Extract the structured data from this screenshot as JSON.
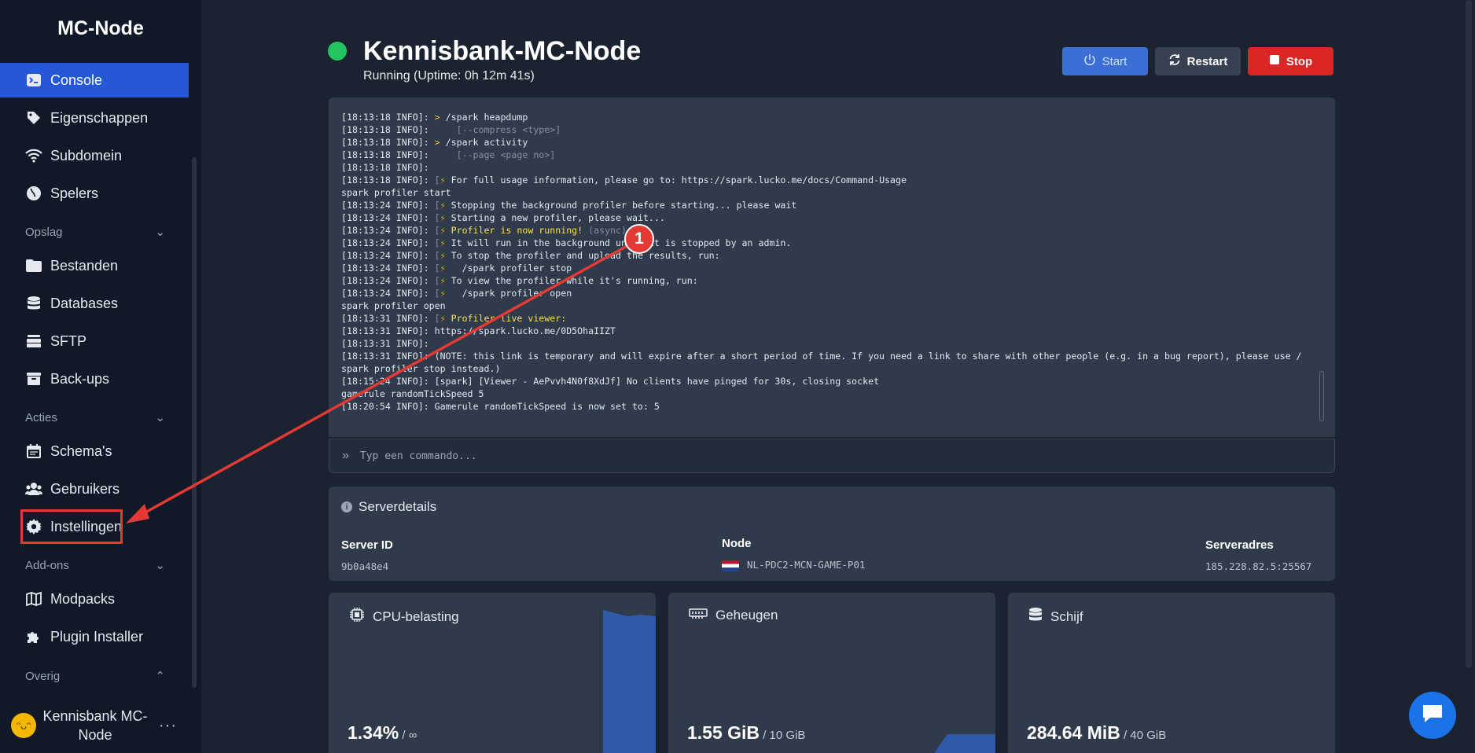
{
  "sidebar": {
    "brand": "MC-Node",
    "top_items": [
      {
        "label": "Console",
        "icon": "terminal-icon"
      },
      {
        "label": "Eigenschappen",
        "icon": "tag-icon"
      },
      {
        "label": "Subdomein",
        "icon": "wifi-icon"
      },
      {
        "label": "Spelers",
        "icon": "globe-icon"
      }
    ],
    "sections": [
      {
        "label": "Opslag",
        "items": [
          {
            "label": "Bestanden",
            "icon": "folder-icon"
          },
          {
            "label": "Databases",
            "icon": "database-icon"
          },
          {
            "label": "SFTP",
            "icon": "server-icon"
          },
          {
            "label": "Back-ups",
            "icon": "archive-icon"
          }
        ]
      },
      {
        "label": "Acties",
        "items": [
          {
            "label": "Schema's",
            "icon": "calendar-icon"
          },
          {
            "label": "Gebruikers",
            "icon": "users-icon"
          },
          {
            "label": "Instellingen",
            "icon": "gear-icon"
          }
        ]
      },
      {
        "label": "Add-ons",
        "items": [
          {
            "label": "Modpacks",
            "icon": "map-icon"
          },
          {
            "label": "Plugin Installer",
            "icon": "puzzle-icon"
          }
        ]
      },
      {
        "label": "Overig",
        "items": []
      }
    ],
    "user": {
      "name": "Kennisbank MC-Node",
      "more": "···"
    }
  },
  "server": {
    "title": "Kennisbank-MC-Node",
    "status": "Running (Uptime: 0h 12m 41s)",
    "status_color": "#22c55e",
    "buttons": {
      "start": "Start",
      "restart": "Restart",
      "stop": "Stop"
    }
  },
  "console": {
    "lines": [
      {
        "time": "[18:13:18 INFO]:",
        "parts": [
          {
            "t": " > ",
            "c": "gt"
          },
          {
            "t": "/spark heapdump"
          }
        ]
      },
      {
        "time": "[18:13:18 INFO]:",
        "parts": [
          {
            "t": "     [--compress ",
            "c": "dim"
          },
          {
            "t": "<type>]",
            "c": "dim"
          }
        ]
      },
      {
        "time": "[18:13:18 INFO]:",
        "parts": [
          {
            "t": " > ",
            "c": "gt"
          },
          {
            "t": "/spark activity"
          }
        ]
      },
      {
        "time": "[18:13:18 INFO]:",
        "parts": [
          {
            "t": "     [--page ",
            "c": "dim"
          },
          {
            "t": "<page no>]",
            "c": "dim"
          }
        ]
      },
      {
        "time": "[18:13:18 INFO]:",
        "parts": []
      },
      {
        "time": "[18:13:18 INFO]:",
        "parts": [
          {
            "t": " [",
            "c": "dim"
          },
          {
            "t": "⚡",
            "c": "bolt"
          },
          {
            "t": " For full usage information, please go to: https://spark.lucko.me/docs/Command-Usage"
          }
        ]
      },
      {
        "time": "",
        "parts": [
          {
            "t": "spark profiler start"
          }
        ]
      },
      {
        "time": "[18:13:24 INFO]:",
        "parts": [
          {
            "t": " [",
            "c": "dim"
          },
          {
            "t": "⚡",
            "c": "bolt"
          },
          {
            "t": " Stopping the background profiler before starting... please wait"
          }
        ]
      },
      {
        "time": "[18:13:24 INFO]:",
        "parts": [
          {
            "t": " [",
            "c": "dim"
          },
          {
            "t": "⚡",
            "c": "bolt"
          },
          {
            "t": " Starting a new profiler, please wait..."
          }
        ]
      },
      {
        "time": "[18:13:24 INFO]:",
        "parts": [
          {
            "t": " [",
            "c": "dim"
          },
          {
            "t": "⚡",
            "c": "bolt"
          },
          {
            "t": " Profiler is now running!",
            "c": "yel"
          },
          {
            "t": " (async)",
            "c": "dim"
          }
        ]
      },
      {
        "time": "[18:13:24 INFO]:",
        "parts": [
          {
            "t": " [",
            "c": "dim"
          },
          {
            "t": "⚡",
            "c": "bolt"
          },
          {
            "t": " It will run in the background until it is stopped by an admin."
          }
        ]
      },
      {
        "time": "[18:13:24 INFO]:",
        "parts": [
          {
            "t": " [",
            "c": "dim"
          },
          {
            "t": "⚡",
            "c": "bolt"
          },
          {
            "t": " To stop the profiler and upload the results, run:"
          }
        ]
      },
      {
        "time": "[18:13:24 INFO]:",
        "parts": [
          {
            "t": " [",
            "c": "dim"
          },
          {
            "t": "⚡",
            "c": "bolt"
          },
          {
            "t": "   /spark profiler stop"
          }
        ]
      },
      {
        "time": "[18:13:24 INFO]:",
        "parts": [
          {
            "t": " [",
            "c": "dim"
          },
          {
            "t": "⚡",
            "c": "bolt"
          },
          {
            "t": " To view the profiler while it's running, run:"
          }
        ]
      },
      {
        "time": "[18:13:24 INFO]:",
        "parts": [
          {
            "t": " [",
            "c": "dim"
          },
          {
            "t": "⚡",
            "c": "bolt"
          },
          {
            "t": "   /spark profiler open"
          }
        ]
      },
      {
        "time": "",
        "parts": [
          {
            "t": "spark profiler open"
          }
        ]
      },
      {
        "time": "[18:13:31 INFO]:",
        "parts": [
          {
            "t": " [",
            "c": "dim"
          },
          {
            "t": "⚡",
            "c": "bolt"
          },
          {
            "t": " Profiler live viewer:",
            "c": "yel"
          }
        ]
      },
      {
        "time": "[18:13:31 INFO]:",
        "parts": [
          {
            "t": " https://spark.lucko.me/0D5OhaIIZT"
          }
        ]
      },
      {
        "time": "[18:13:31 INFO]:",
        "parts": []
      },
      {
        "time": "[18:13:31 INFO]:",
        "parts": [
          {
            "t": " (NOTE: this link is temporary and will expire after a short period of time. If you need a link to share with other people (e.g. in a bug report), please use /"
          }
        ]
      },
      {
        "time": "",
        "parts": [
          {
            "t": "spark profiler stop instead.)"
          }
        ]
      },
      {
        "time": "[18:15:24 INFO]:",
        "parts": [
          {
            "t": " [spark] [Viewer - AePvvh4N0f8XdJf] No clients have pinged for 30s, closing socket"
          }
        ]
      },
      {
        "time": "",
        "parts": [
          {
            "t": "gamerule randomTickSpeed 5"
          }
        ]
      },
      {
        "time": "[18:20:54 INFO]:",
        "parts": [
          {
            "t": " Gamerule randomTickSpeed is now set to: 5"
          }
        ]
      }
    ],
    "input_placeholder": "Typ een commando..."
  },
  "details": {
    "heading": "Serverdetails",
    "server_id_label": "Server ID",
    "server_id": "9b0a48e4",
    "node_label": "Node",
    "node": "NL-PDC2-MCN-GAME-P01",
    "address_label": "Serveradres",
    "address": "185.228.82.5:25567"
  },
  "stats": {
    "cpu": {
      "label": "CPU-belasting",
      "value": "1.34%",
      "limit": " / ∞"
    },
    "memory": {
      "label": "Geheugen",
      "value": "1.55 GiB",
      "limit": " / 10 GiB"
    },
    "disk": {
      "label": "Schijf",
      "value": "284.64 MiB",
      "limit": " / 40 GiB"
    }
  },
  "annotation": {
    "badge": "1",
    "color": "#e53935"
  },
  "colors": {
    "accent": "#2557d6",
    "stop": "#dc2626",
    "start": "#3b6fd4"
  }
}
